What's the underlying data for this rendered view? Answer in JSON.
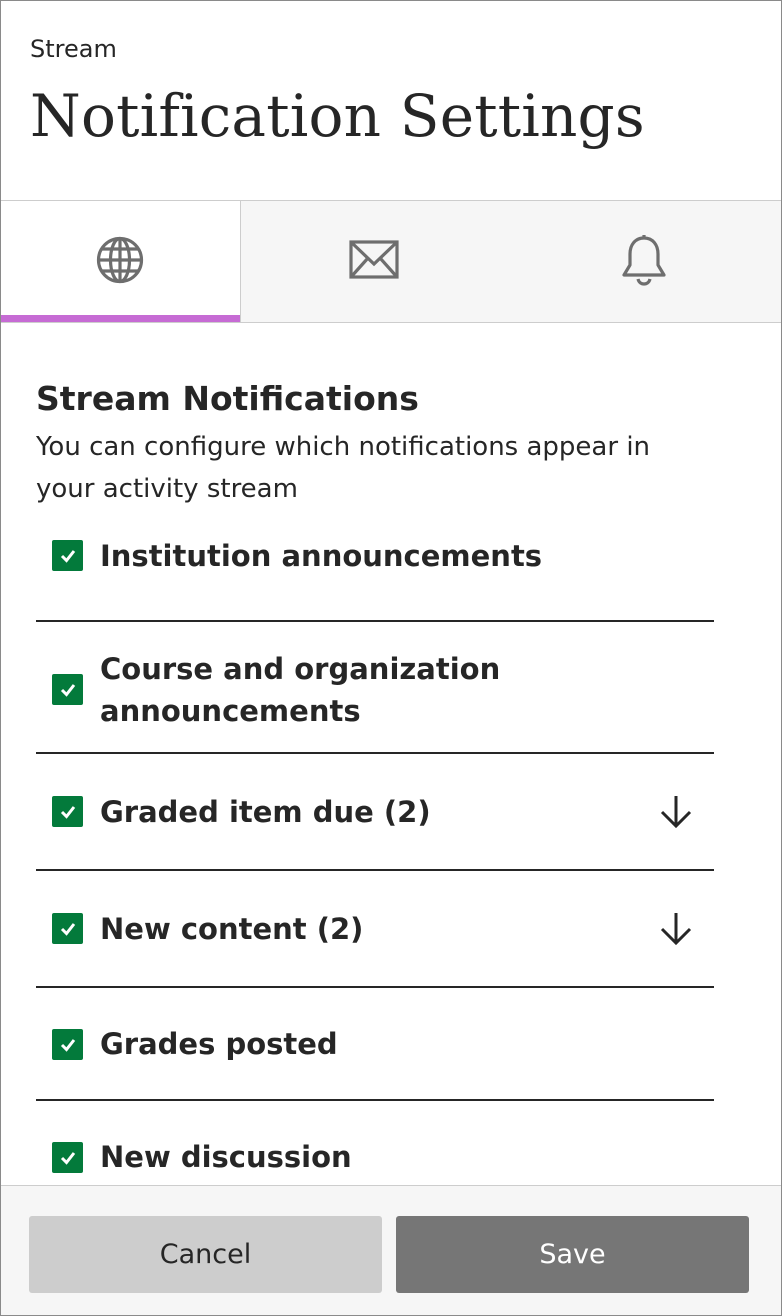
{
  "header": {
    "breadcrumb": "Stream",
    "title": "Notification Settings"
  },
  "tabs": [
    {
      "icon": "globe-icon",
      "selected": true
    },
    {
      "icon": "envelope-icon",
      "selected": false
    },
    {
      "icon": "bell-icon",
      "selected": false
    }
  ],
  "section": {
    "title": "Stream Notifications",
    "description": "You can configure which notifications appear in your activity stream"
  },
  "items": [
    {
      "label": "Institution announcements",
      "checked": true,
      "expandable": false
    },
    {
      "label": "Course and organization announcements",
      "checked": true,
      "expandable": false
    },
    {
      "label": "Graded item due (2)",
      "checked": true,
      "expandable": true
    },
    {
      "label": "New content (2)",
      "checked": true,
      "expandable": true
    },
    {
      "label": "Grades posted",
      "checked": true,
      "expandable": false
    },
    {
      "label": "New discussion",
      "checked": true,
      "expandable": false
    }
  ],
  "footer": {
    "cancel_label": "Cancel",
    "save_label": "Save"
  },
  "colors": {
    "accent": "#c66bd4",
    "checkbox": "#037a3b",
    "save_button": "#767676",
    "cancel_button": "#cdcdcd"
  }
}
